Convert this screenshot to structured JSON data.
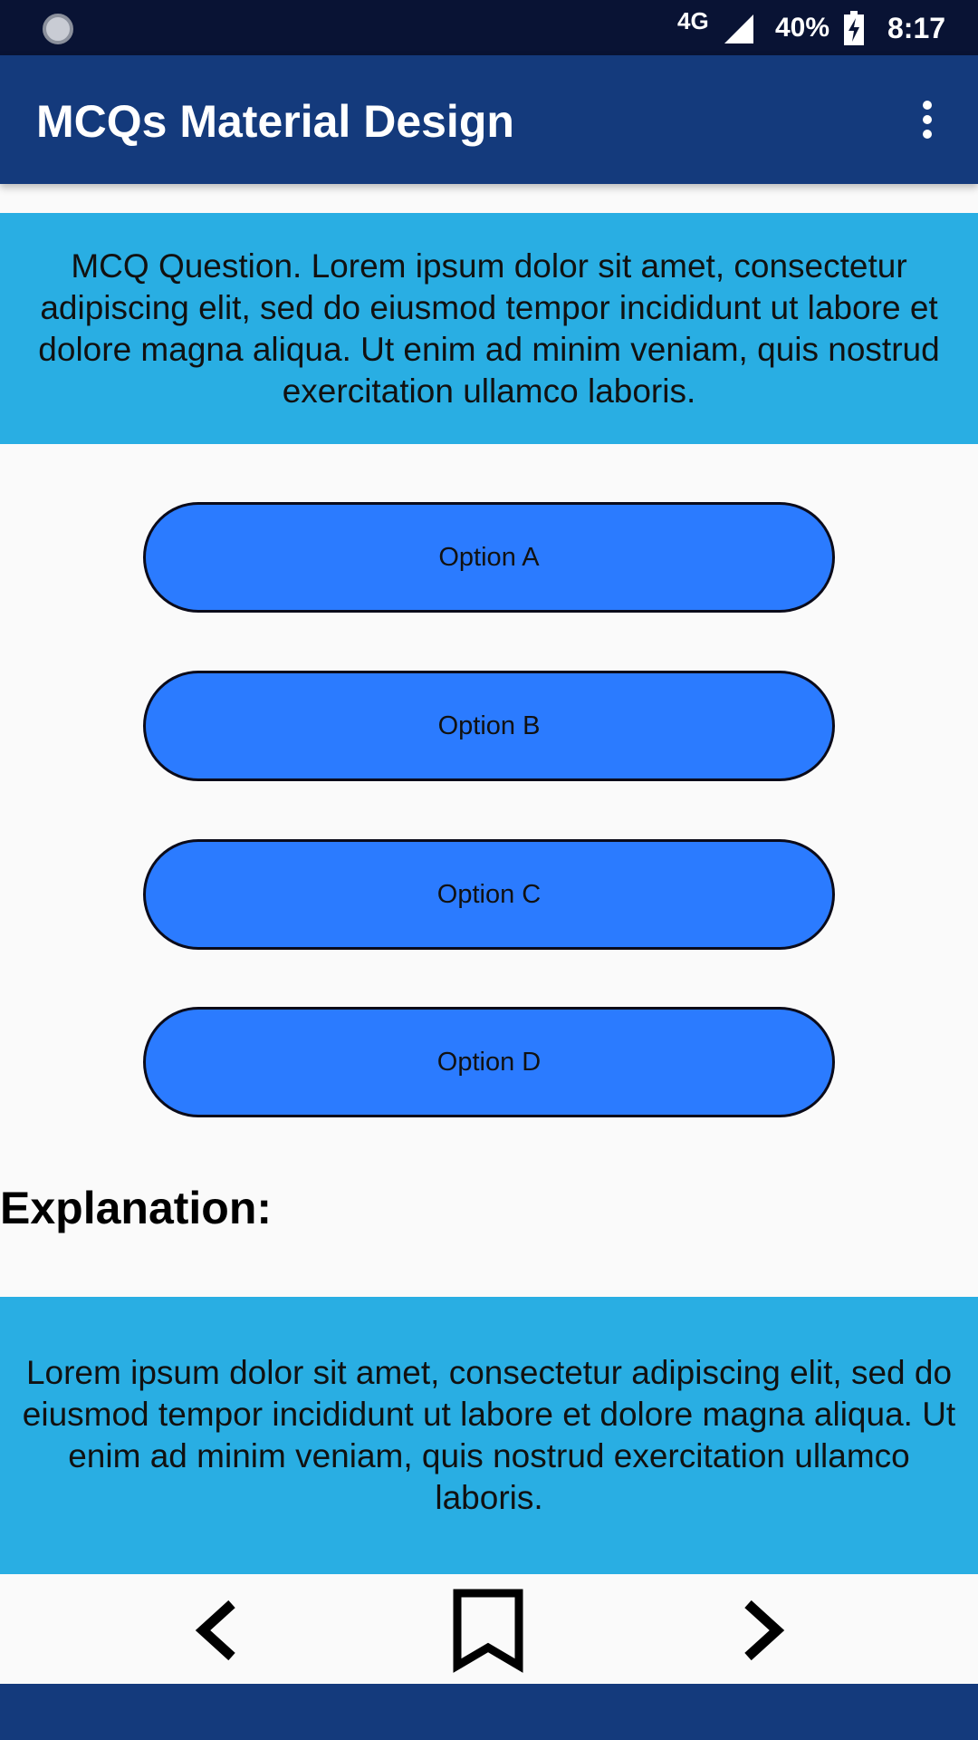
{
  "status_bar": {
    "network": "4G",
    "battery": "40%",
    "time": "8:17",
    "icons": [
      "app-notification-icon",
      "signal-icon",
      "battery-charging-icon"
    ]
  },
  "app_bar": {
    "title": "MCQs Material Design",
    "menu_icon": "overflow-menu-icon"
  },
  "question": {
    "text": "MCQ Question. Lorem ipsum dolor sit amet, consectetur adipiscing elit, sed do eiusmod tempor incididunt ut labore et dolore magna aliqua. Ut enim ad minim veniam, quis nostrud exercitation ullamco laboris."
  },
  "options": [
    {
      "label": "Option A"
    },
    {
      "label": "Option B"
    },
    {
      "label": "Option C"
    },
    {
      "label": "Option D"
    }
  ],
  "explanation": {
    "heading": "Explanation:",
    "text": "Lorem ipsum dolor sit amet, consectetur adipiscing elit, sed do eiusmod tempor incididunt ut labore et dolore magna aliqua. Ut enim ad minim veniam, quis nostrud exercitation ullamco laboris."
  },
  "bottom_nav": {
    "icons": [
      "chevron-left-icon",
      "bookmark-icon",
      "chevron-right-icon"
    ]
  },
  "colors": {
    "status_bar": "#091334",
    "app_bar": "#143a7c",
    "info_box": "#29aee3",
    "option_button": "#2b7bff",
    "background": "#fafafa"
  }
}
